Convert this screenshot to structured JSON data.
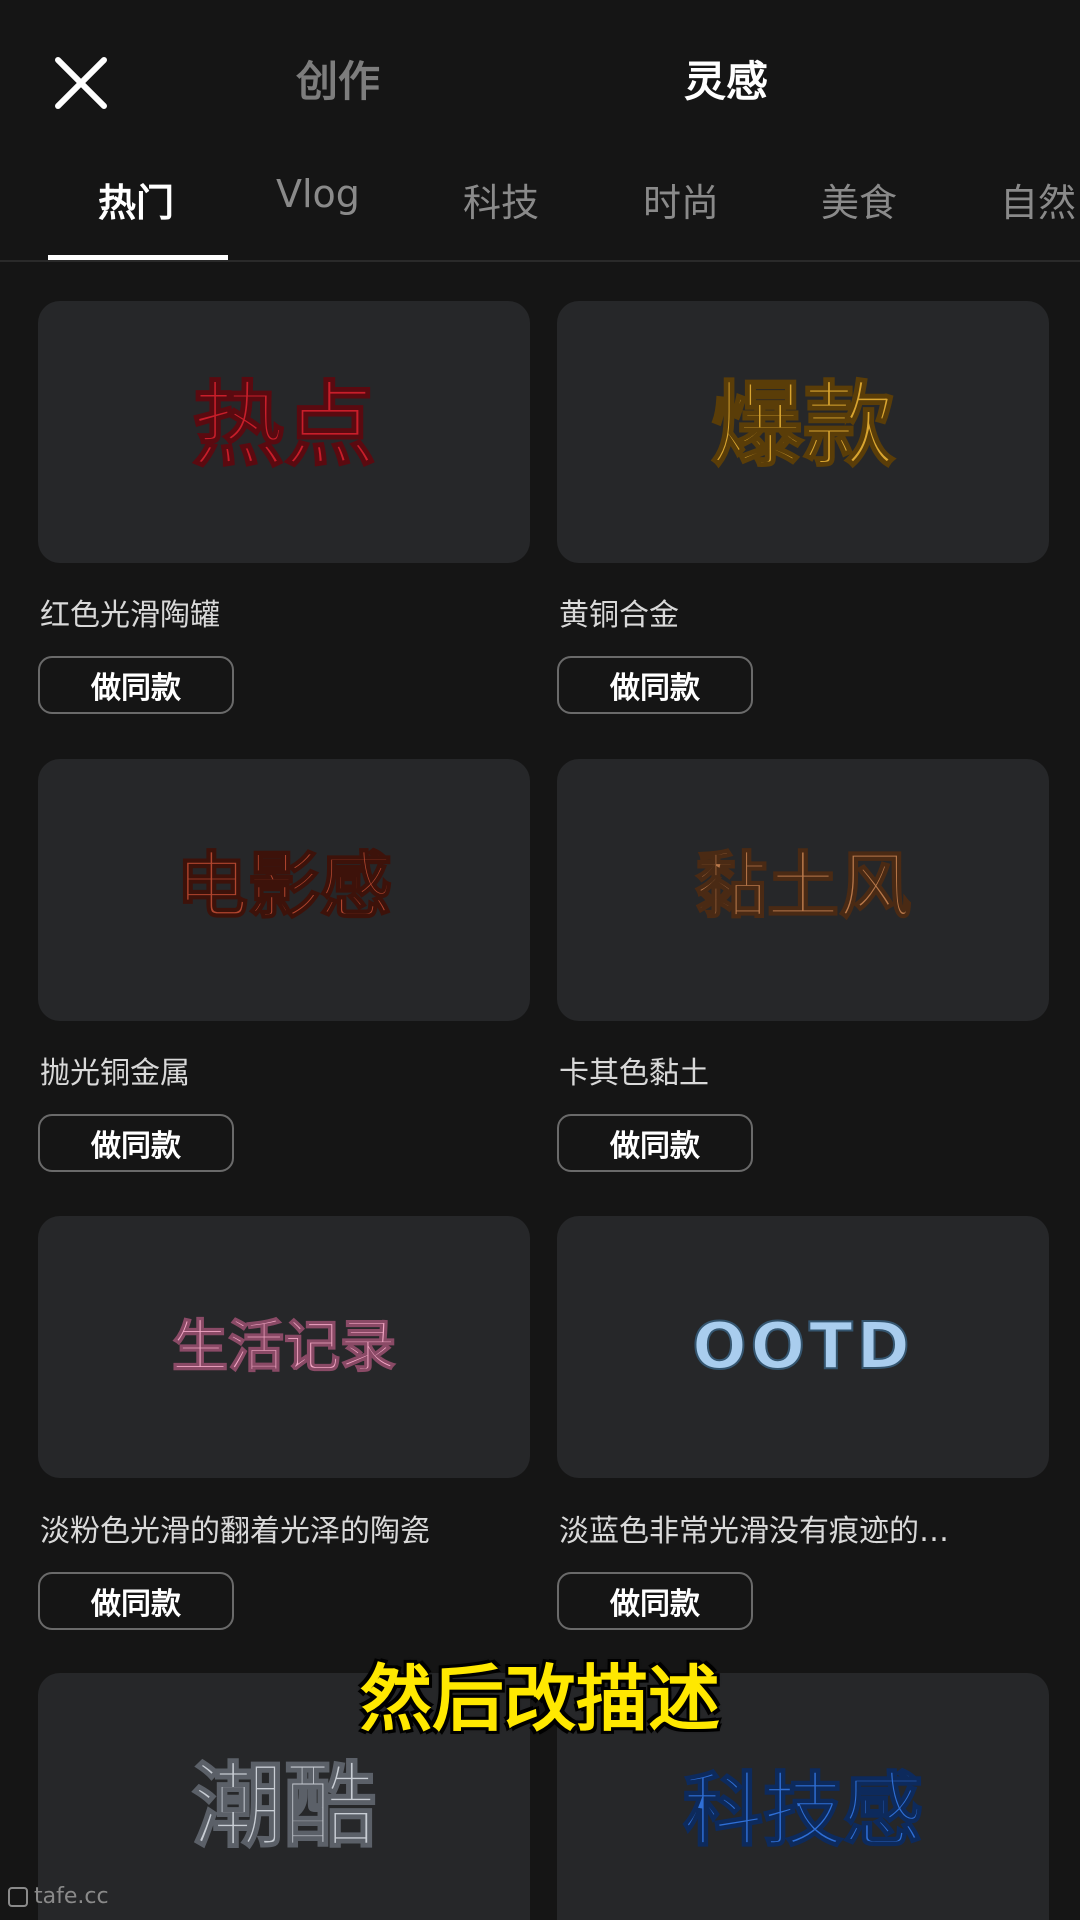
{
  "header": {
    "close_icon": "close-icon",
    "tabs": [
      {
        "label": "创作",
        "active": false
      },
      {
        "label": "灵感",
        "active": true
      }
    ]
  },
  "categories": [
    {
      "label": "热门",
      "active": true
    },
    {
      "label": "Vlog",
      "active": false
    },
    {
      "label": "科技",
      "active": false
    },
    {
      "label": "时尚",
      "active": false
    },
    {
      "label": "美食",
      "active": false
    },
    {
      "label": "自然",
      "active": false
    }
  ],
  "templates": [
    {
      "art_text": "热点",
      "label": "红色光滑陶罐",
      "button": "做同款",
      "color": "#c81e2a"
    },
    {
      "art_text": "爆款",
      "label": "黄铜合金",
      "button": "做同款",
      "color": "#d9a530"
    },
    {
      "art_text": "电影感",
      "label": "抛光铜金属",
      "button": "做同款",
      "color": "#b0452e"
    },
    {
      "art_text": "黏土风",
      "label": "卡其色黏土",
      "button": "做同款",
      "color": "#b8784a"
    },
    {
      "art_text": "生活记录",
      "label": "淡粉色光滑的翻着光泽的陶瓷",
      "button": "做同款",
      "color": "#f3a6c4"
    },
    {
      "art_text": "OOTD",
      "label": "淡蓝色非常光滑没有痕迹的…",
      "button": "做同款",
      "color": "#a9cdee"
    },
    {
      "art_text": "潮酷",
      "label": "",
      "button": "",
      "color": "#c8cdd4"
    },
    {
      "art_text": "科技感",
      "label": "",
      "button": "",
      "color": "#2f6fd6"
    }
  ],
  "caption": "然后改描述",
  "watermark": "tafe.cc"
}
